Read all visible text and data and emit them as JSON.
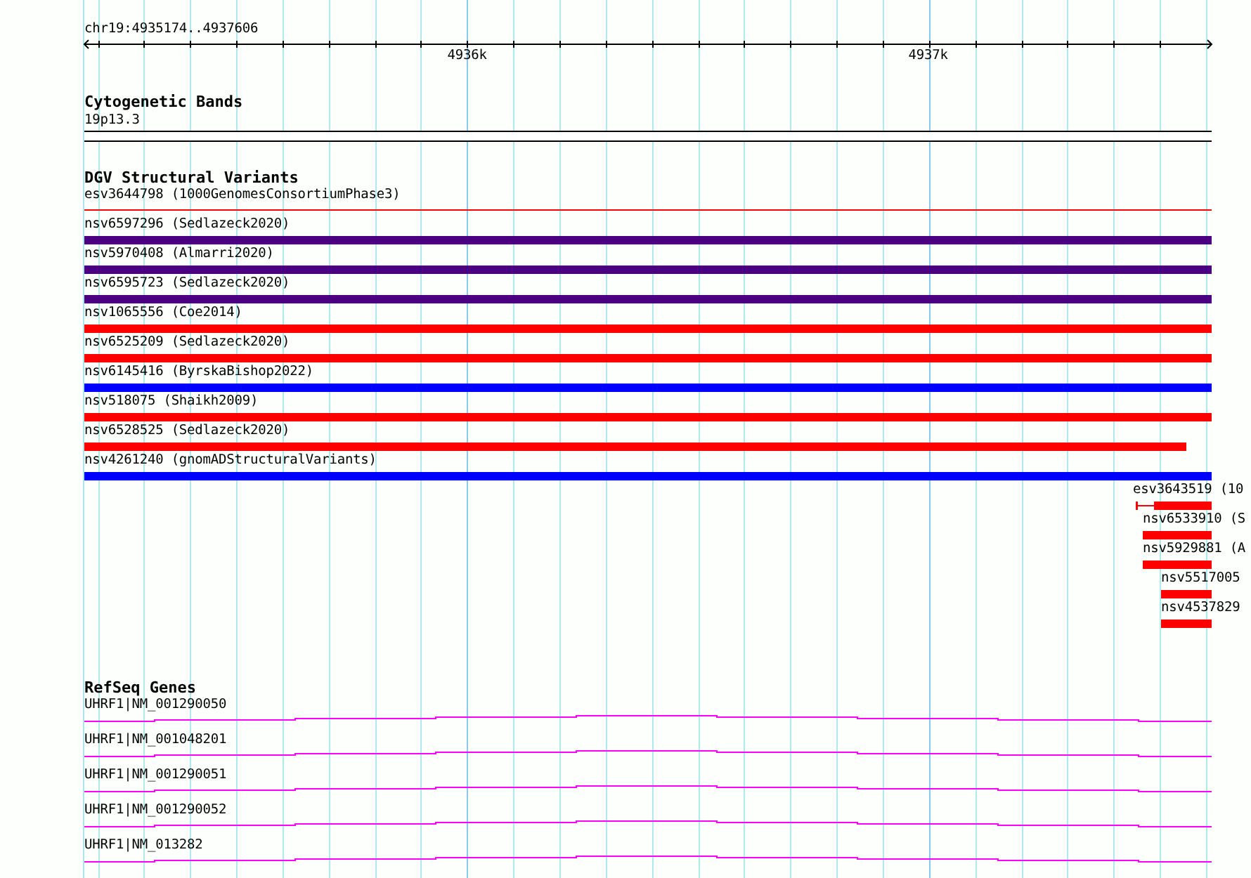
{
  "ruler": {
    "location": "chr19:4935174..4937606",
    "ticks": [
      "4936k",
      "4937k"
    ]
  },
  "tracks": [
    {
      "kind": "bands",
      "title": "Cytogenetic Bands",
      "features": [
        {
          "label": "19p13.3"
        }
      ]
    },
    {
      "kind": "variants",
      "title": "DGV Structural Variants",
      "features": [
        {
          "kind": "line",
          "label": "esv3644798 (1000GenomesConsortiumPhase3)",
          "color": "#ff0000"
        },
        {
          "kind": "bar",
          "label": "nsv6597296 (Sedlazeck2020)",
          "color": "#4b0082"
        },
        {
          "kind": "bar",
          "label": "nsv5970408 (Almarri2020)",
          "color": "#4b0082"
        },
        {
          "kind": "bar",
          "label": "nsv6595723 (Sedlazeck2020)",
          "color": "#4b0082"
        },
        {
          "kind": "bar",
          "label": "nsv1065556 (Coe2014)",
          "color": "#ff0000"
        },
        {
          "kind": "bar",
          "label": "nsv6525209 (Sedlazeck2020)",
          "color": "#ff0000"
        },
        {
          "kind": "bar",
          "label": "nsv6145416 (ByrskaBishop2022)",
          "color": "#0000ff"
        },
        {
          "kind": "bar",
          "label": "nsv518075 (Shaikh2009)",
          "color": "#ff0000"
        },
        {
          "kind": "bar",
          "label": "nsv6528525 (Sedlazeck2020)",
          "color": "#ff0000"
        },
        {
          "kind": "bar",
          "label": "nsv4261240 (gnomADStructuralVariants)",
          "color": "#0000ff"
        },
        {
          "kind": "split",
          "label": "esv3643519 (10",
          "color": "#ff0000"
        },
        {
          "kind": "bar",
          "label": "nsv6533910 (S",
          "color": "#ff0000"
        },
        {
          "kind": "bar",
          "label": "nsv5929881 (A",
          "color": "#ff0000"
        },
        {
          "kind": "bar",
          "label": "nsv5517005",
          "color": "#ff0000"
        },
        {
          "kind": "bar",
          "label": "nsv4537829",
          "color": "#ff0000"
        }
      ]
    },
    {
      "kind": "genes",
      "title": "RefSeq Genes",
      "features": [
        {
          "label": "UHRF1|NM_001290050"
        },
        {
          "label": "UHRF1|NM_001048201"
        },
        {
          "label": "UHRF1|NM_001290051"
        },
        {
          "label": "UHRF1|NM_001290052"
        },
        {
          "label": "UHRF1|NM_013282"
        }
      ]
    }
  ]
}
